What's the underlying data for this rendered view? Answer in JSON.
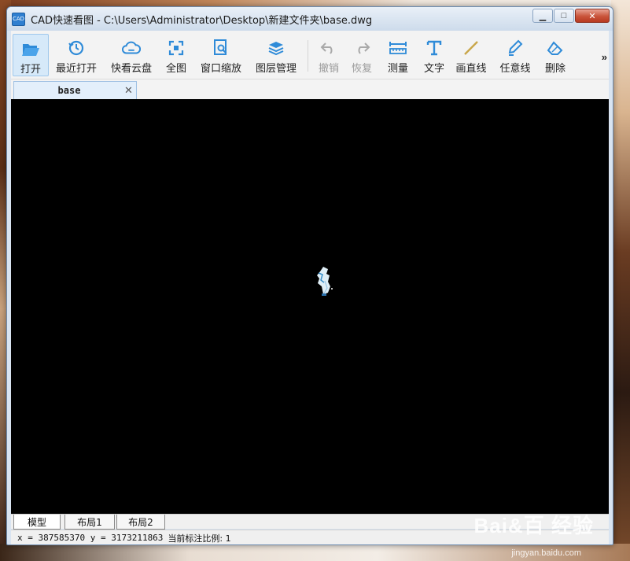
{
  "window": {
    "app_icon_text": "CAD",
    "title": "CAD快速看图 - C:\\Users\\Administrator\\Desktop\\新建文件夹\\base.dwg",
    "controls": {
      "minimize": "▁",
      "maximize": "□",
      "close": "✕"
    }
  },
  "toolbar": {
    "items": [
      {
        "label": "打开",
        "icon": "folder-open-icon",
        "state": "active"
      },
      {
        "label": "最近打开",
        "icon": "history-icon",
        "state": "normal"
      },
      {
        "label": "快看云盘",
        "icon": "cloud-icon",
        "state": "normal"
      },
      {
        "label": "全图",
        "icon": "fit-all-icon",
        "state": "normal"
      },
      {
        "label": "窗口缩放",
        "icon": "zoom-window-icon",
        "state": "normal"
      },
      {
        "label": "图层管理",
        "icon": "layers-icon",
        "state": "normal"
      },
      {
        "label": "撤销",
        "icon": "undo-icon",
        "state": "disabled"
      },
      {
        "label": "恢复",
        "icon": "redo-icon",
        "state": "disabled"
      },
      {
        "label": "测量",
        "icon": "measure-icon",
        "state": "normal"
      },
      {
        "label": "文字",
        "icon": "text-icon",
        "state": "normal"
      },
      {
        "label": "画直线",
        "icon": "line-icon",
        "state": "normal"
      },
      {
        "label": "任意线",
        "icon": "freehand-pen-icon",
        "state": "normal"
      },
      {
        "label": "删除",
        "icon": "eraser-icon",
        "state": "normal"
      }
    ],
    "more": "»"
  },
  "doc_tabs": [
    {
      "name": "base",
      "close": "✕"
    }
  ],
  "layout_tabs": [
    {
      "label": "模型",
      "active": true
    },
    {
      "label": "布局1",
      "active": false
    },
    {
      "label": "布局2",
      "active": false
    }
  ],
  "status": {
    "coords": "x = 387585370 y = 3173211863",
    "scale": "当前标注比例: 1"
  },
  "watermark": {
    "main": "Bai&百 经验",
    "sub": "jingyan.baidu.com"
  },
  "colors": {
    "canvas": "#000000",
    "accent": "#2f8bd8",
    "active_tab": "#d6e9f9"
  }
}
